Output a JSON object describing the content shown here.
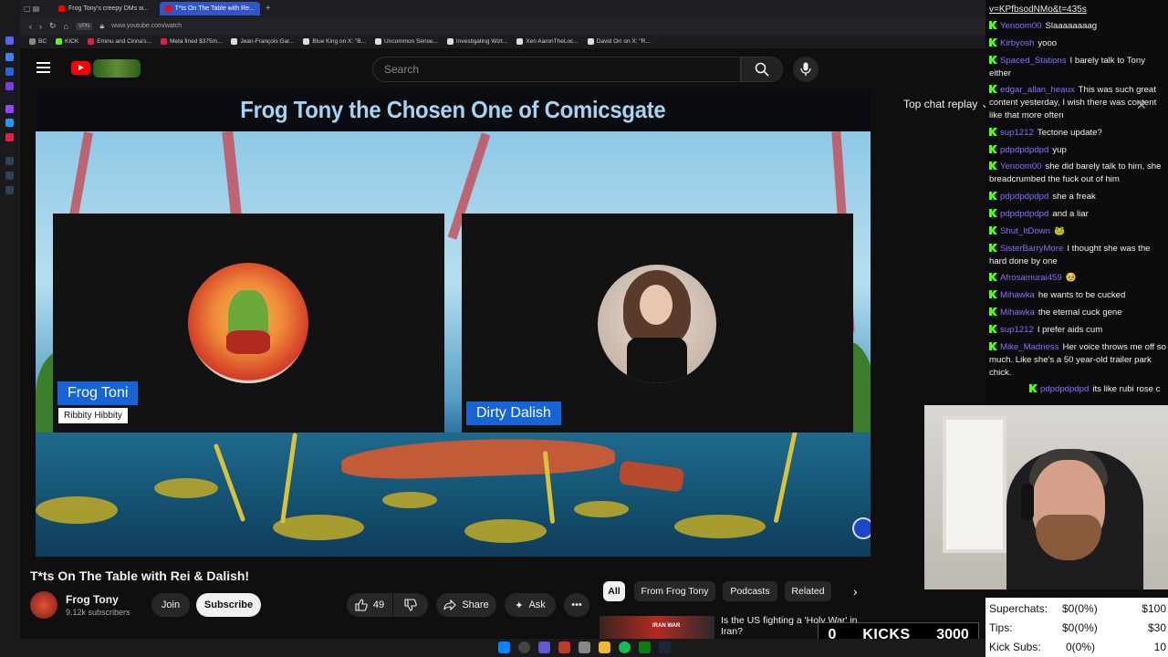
{
  "browser": {
    "tabs": [
      {
        "label": "Frog Tony's creepy DMs w...",
        "active": false
      },
      {
        "label": "T*ts On The Table with Re...",
        "active": true
      }
    ],
    "address": "www.youtube.com/watch",
    "address_badge": "VPN",
    "bookmarks": [
      "BC",
      "KICK",
      "Eminu and Cinna's...",
      "Meta fined $375m...",
      "Jean-François Gar...",
      "Blue King on X: \"B...",
      "Uncommon Sense...",
      "Investigating Wizt...",
      "Xen AaronTheLoc...",
      "David Orr on X: \"R..."
    ]
  },
  "youtube": {
    "search_placeholder": "Search",
    "video": {
      "banner_title": "Frog Tony the Chosen One of Comicsgate",
      "left_name": "Frog Toni",
      "left_sub": "Ribbity Hibbity",
      "right_name": "Dirty Dalish"
    },
    "chat_replay_label": "Top chat replay",
    "page_title": "T*ts On The Table with Rei & Dalish!",
    "channel": {
      "name": "Frog Tony",
      "subs": "9.12k subscribers"
    },
    "actions": {
      "join": "Join",
      "subscribe": "Subscribe",
      "likes": "49",
      "share": "Share",
      "ask": "Ask"
    },
    "chips": [
      "All",
      "From Frog Tony",
      "Podcasts",
      "Related"
    ],
    "recommendation": {
      "title": "Is the US fighting a 'Holy War' in",
      "title_cont": "Iran?",
      "thumb_text": "IRAN WAR"
    }
  },
  "chat": {
    "url": "v=KPfbsodNMo&t=435s",
    "messages": [
      {
        "user": "Yenoom00",
        "text": "Slaaaaaaaag"
      },
      {
        "user": "Kirbyosh",
        "text": "yooo"
      },
      {
        "user": "Spaced_Stations",
        "text": "I barely talk to Tony either"
      },
      {
        "user": "edgar_allan_heaux",
        "text": "This was such great content yesterday, I wish there was content like that more often"
      },
      {
        "user": "sup1212",
        "text": "Tectone update?"
      },
      {
        "user": "pdpdpdpdpd",
        "text": "yup"
      },
      {
        "user": "Yenoom00",
        "text": "she did barely talk to him, she breadcrumbed the fuck out of him"
      },
      {
        "user": "pdpdpdpdpd",
        "text": "she a freak"
      },
      {
        "user": "pdpdpdpdpd",
        "text": "and a liar"
      },
      {
        "user": "Shut_ItDown",
        "text": "🐸"
      },
      {
        "user": "SisterBarryMore",
        "text": "I thought she was the hard done by one"
      },
      {
        "user": "Afrosamurai459",
        "text": "🥹"
      },
      {
        "user": "Mihawka",
        "text": "he wants to be cucked"
      },
      {
        "user": "Mihawka",
        "text": "the eternal cuck gene"
      },
      {
        "user": "sup1212",
        "text": "I prefer aids cum"
      },
      {
        "user": "Mike_Madness",
        "text": "Her voice throws me off so much. Like she's a 50 year-old trailer park chick."
      },
      {
        "user": "pdpdpdpdpd",
        "text": "its like rubi rose c"
      }
    ]
  },
  "kicks_goal": {
    "current": "0",
    "label": "KICKS",
    "target": "3000"
  },
  "stats": [
    {
      "label": "Superchats:",
      "value": "$0(0%)",
      "goal": "$100"
    },
    {
      "label": "Tips:",
      "value": "$0(0%)",
      "goal": "$30"
    },
    {
      "label": "Kick Subs:",
      "value": "0(0%)",
      "goal": "10"
    }
  ],
  "colors": {
    "accent_blue": "#1565d8",
    "kick_green": "#53fc18",
    "yt_red": "#ff0000",
    "chat_user": "#8f6bff"
  }
}
